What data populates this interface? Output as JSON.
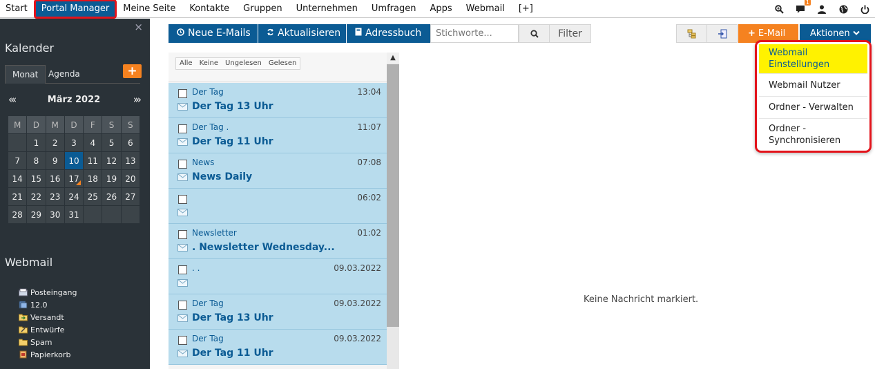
{
  "topnav": {
    "items": [
      "Start",
      "Portal Manager",
      "Meine Seite",
      "Kontakte",
      "Gruppen",
      "Unternehmen",
      "Umfragen",
      "Apps",
      "Webmail",
      "[+]"
    ],
    "active_index": 1,
    "chat_badge": "1",
    "icons": [
      "search-zoom-icon",
      "chat-icon",
      "user-icon",
      "globe-icon",
      "power-icon"
    ]
  },
  "sidebar": {
    "close_label": "×",
    "calendar_title": "Kalender",
    "tabs": [
      "Monat",
      "Agenda"
    ],
    "add_label": "+",
    "month": "März 2022",
    "prev_label": "«‹",
    "next_label": "›»",
    "weekdays": [
      "M",
      "D",
      "M",
      "D",
      "F",
      "S",
      "S"
    ],
    "weeks": [
      [
        "",
        "1",
        "2",
        "3",
        "4",
        "5",
        "6"
      ],
      [
        "7",
        "8",
        "9",
        "10",
        "11",
        "12",
        "13"
      ],
      [
        "14",
        "15",
        "16",
        "17",
        "18",
        "19",
        "20"
      ],
      [
        "21",
        "22",
        "23",
        "24",
        "25",
        "26",
        "27"
      ],
      [
        "28",
        "29",
        "30",
        "31",
        "",
        "",
        ""
      ]
    ],
    "today": "10",
    "marked": "17",
    "webmail_title": "Webmail",
    "folders": [
      {
        "label": "Posteingang",
        "icon": "inbox-icon"
      },
      {
        "label": "12.0",
        "icon": "folder-blue-icon"
      },
      {
        "label": "Versandt",
        "icon": "sent-folder-icon"
      },
      {
        "label": "Entwürfe",
        "icon": "drafts-folder-icon"
      },
      {
        "label": "Spam",
        "icon": "spam-folder-icon"
      },
      {
        "label": "Papierkorb",
        "icon": "trash-icon"
      }
    ]
  },
  "toolbar": {
    "new_mails": "Neue E-Mails",
    "refresh": "Aktualisieren",
    "addressbook": "Adressbuch",
    "search_placeholder": "Stichworte...",
    "filter": "Filter",
    "new_email": "E-Mail",
    "actions": "Aktionen"
  },
  "list": {
    "filters": [
      "Alle",
      "Keine",
      "Ungelesen",
      "Gelesen"
    ],
    "messages": [
      {
        "sender": "Der Tag",
        "time": "13:04",
        "subject": "Der Tag 13 Uhr"
      },
      {
        "sender": "Der Tag            .",
        "time": "11:07",
        "subject": "Der Tag 11 Uhr"
      },
      {
        "sender": "         News",
        "time": "07:08",
        "subject": "News Daily"
      },
      {
        "sender": "",
        "time": "06:02",
        "subject": ""
      },
      {
        "sender": "Newsletter",
        "time": "01:02",
        "subject": "                  . Newsletter Wednesday..."
      },
      {
        "sender": ".                                              .",
        "time": "09.03.2022",
        "subject": ""
      },
      {
        "sender": "Der Tag",
        "time": "09.03.2022",
        "subject": "Der Tag 13 Uhr"
      },
      {
        "sender": "Der Tag",
        "time": "09.03.2022",
        "subject": "Der Tag 11 Uhr"
      }
    ]
  },
  "preview": {
    "empty": "Keine Nachricht markiert."
  },
  "dropdown": {
    "items": [
      {
        "label": "Webmail Einstellungen",
        "highlighted": true
      },
      {
        "label": "Webmail Nutzer",
        "highlighted": false
      },
      {
        "label": "Ordner - Verwalten",
        "highlighted": false
      },
      {
        "label": "Ordner - Synchronisieren",
        "highlighted": false
      }
    ]
  },
  "colors": {
    "primary": "#0b5b94",
    "accent": "#f58220",
    "highlight": "#e3131b",
    "sidebar": "#2a3238"
  }
}
